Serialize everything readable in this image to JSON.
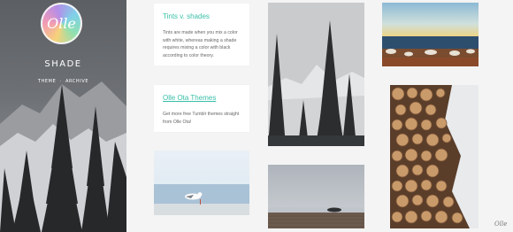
{
  "sidebar": {
    "logo_text": "Olle",
    "site_title": "SHADE",
    "nav": [
      "THEME",
      "ARCHIVE"
    ],
    "nav_separator": "·"
  },
  "posts": [
    {
      "title": "Tints v. shades",
      "body": "Tints are made when you mix a color with white, whereas making a shade requires mixing a color with black according to color theory."
    },
    {
      "title": "Olle Ota Themes",
      "body": "Get more free Tumblr themes straight from Olle Ota!"
    }
  ],
  "photos": [
    {
      "icon": "snowy-forest-photo"
    },
    {
      "icon": "sunset-sea-photo"
    },
    {
      "icon": "log-pile-photo"
    },
    {
      "icon": "seagull-photo"
    },
    {
      "icon": "pier-fog-photo"
    }
  ],
  "corner_mark": "Olle",
  "colors": {
    "accent": "#38bfa8",
    "background": "#f4f4f4"
  }
}
